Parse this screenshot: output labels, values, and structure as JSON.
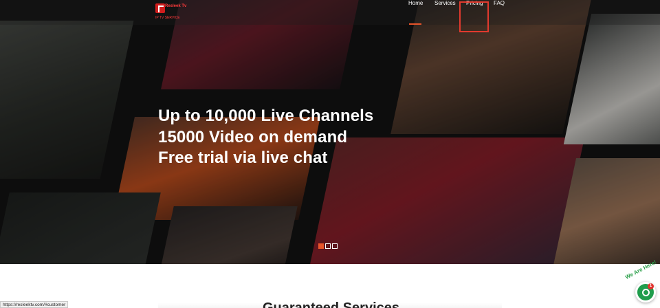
{
  "brand": {
    "name": "Resleek Tv",
    "sub": "IP TV SERVICE"
  },
  "nav": {
    "home": "Home",
    "services": "Services",
    "pricing": "Pricing",
    "faq": "FAQ"
  },
  "hero": {
    "line1": "Up to 10,000 Live Channels",
    "line2": "15000 Video on demand",
    "line3": "Free trial via live chat"
  },
  "slider": {
    "count": 3,
    "active_index": 0
  },
  "section": {
    "title": "Guaranteed Services"
  },
  "status_bar": {
    "url": "https://resleektv.com/#customer"
  },
  "chat": {
    "label": "We Are Here!",
    "badge": "1",
    "color": "#1f9d4c"
  },
  "colors": {
    "accent": "#e8542a",
    "highlight": "#e23a2e",
    "brand_red": "#d11d1d"
  }
}
